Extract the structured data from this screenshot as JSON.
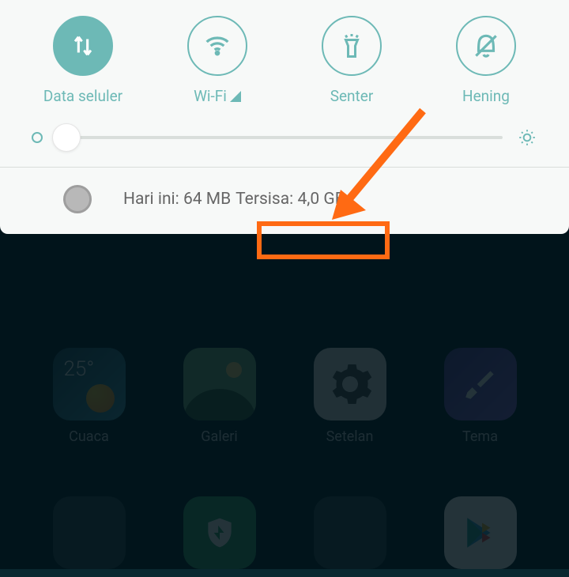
{
  "toggles": {
    "data": "Data seluler",
    "wifi": "Wi-Fi",
    "flashlight": "Senter",
    "silent": "Hening"
  },
  "usage": {
    "today": "Hari ini: 64 MB",
    "remaining": "Tersisa: 4,0 GB"
  },
  "apps": {
    "weather": {
      "label": "Cuaca",
      "temp": "25°"
    },
    "gallery": "Galeri",
    "settings": "Setelan",
    "themes": "Tema"
  }
}
